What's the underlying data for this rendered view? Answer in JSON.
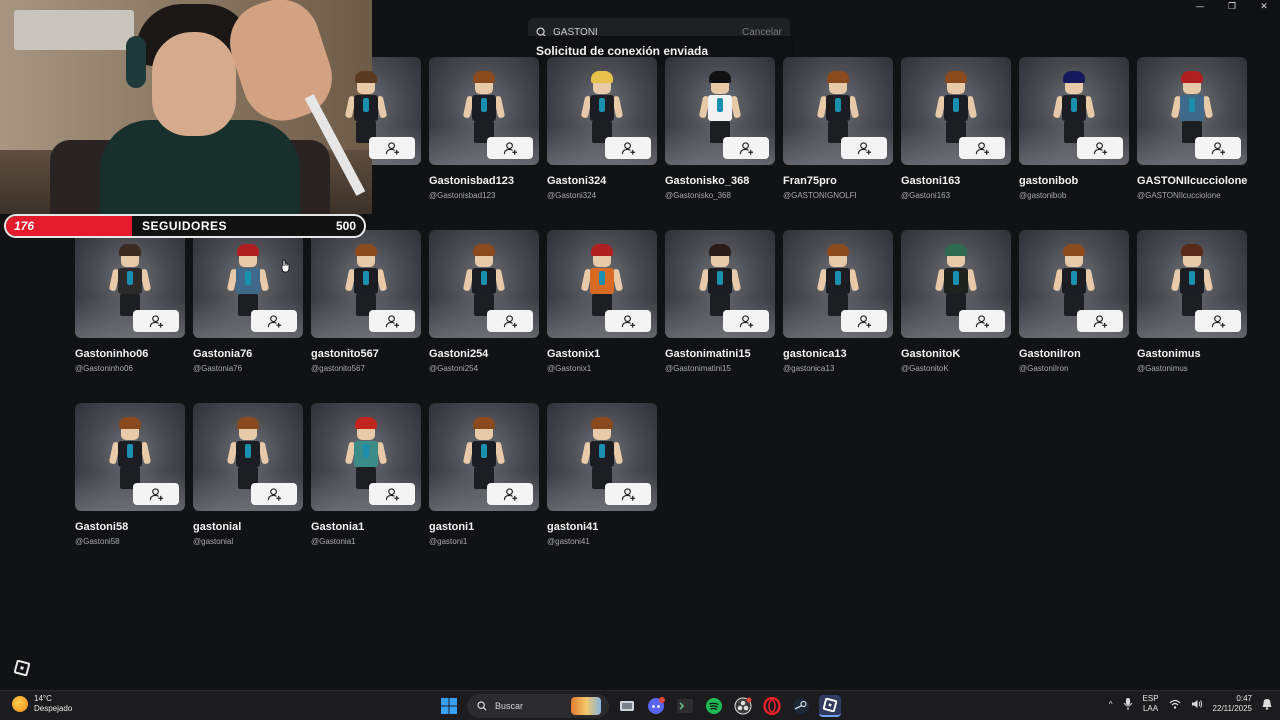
{
  "window": {
    "minimize": "—",
    "restore": "❐",
    "close": "✕"
  },
  "search": {
    "query": "GASTONI",
    "cancel_label": "Cancelar"
  },
  "toast": {
    "message": "Solicitud de conexión enviada"
  },
  "overlay": {
    "followers_current": "176",
    "followers_label": "SEGUIDORES",
    "followers_goal": "500",
    "followers_fraction": 0.352
  },
  "users": [
    {
      "name": "",
      "handle": "",
      "hair": "#5a3b21",
      "shirt": "#1c1d22",
      "head": "#dadde3"
    },
    {
      "name": "Gastonisbad123",
      "handle": "@Gastonisbad123",
      "hair": "#8a4a1e",
      "shirt": "#1c1d22"
    },
    {
      "name": "Gastoni324",
      "handle": "@Gastoni324",
      "hair": "#e6c24a",
      "shirt": "#1c1d22"
    },
    {
      "name": "Gastonisko_368",
      "handle": "@Gastonisko_368",
      "hair": "#111111",
      "shirt": "#f2f2f2"
    },
    {
      "name": "Fran75pro",
      "handle": "@GASTONIGNOLFI",
      "hair": "#8a4a1e",
      "shirt": "#1c1d22"
    },
    {
      "name": "Gastoni163",
      "handle": "@Gastoni163",
      "hair": "#8a4a1e",
      "shirt": "#1c1d22"
    },
    {
      "name": "gastonibob",
      "handle": "@gastonibob",
      "hair": "#151a5c",
      "shirt": "#1c1d22"
    },
    {
      "name": "GASTONIlcucciolone",
      "handle": "@GASTONIlcucciolone",
      "hair": "#b02020",
      "shirt": "#3f6a8c"
    },
    {
      "name": "Gastoninho06",
      "handle": "@Gastoninho06",
      "hair": "#3a2a22",
      "shirt": "#2b2b2b"
    },
    {
      "name": "Gastonia76",
      "handle": "@Gastonia76",
      "hair": "#b02020",
      "shirt": "#3f6a8c"
    },
    {
      "name": "gastonito567",
      "handle": "@gastonito567",
      "hair": "#8a4a1e",
      "shirt": "#1c1d22"
    },
    {
      "name": "Gastoni254",
      "handle": "@Gastoni254",
      "hair": "#8a4a1e",
      "shirt": "#1c1d22"
    },
    {
      "name": "Gastonix1",
      "handle": "@Gastonix1",
      "hair": "#b02020",
      "shirt": "#d86a24"
    },
    {
      "name": "Gastonimatini15",
      "handle": "@Gastonimatini15",
      "hair": "#2b1d17",
      "shirt": "#1c1d22"
    },
    {
      "name": "gastonica13",
      "handle": "@gastonica13",
      "hair": "#8a4a1e",
      "shirt": "#1c1d22"
    },
    {
      "name": "GastonitoK",
      "handle": "@GastonitoK",
      "hair": "#2f6b53",
      "shirt": "#1e2320"
    },
    {
      "name": "GastoniIron",
      "handle": "@GastoniIron",
      "hair": "#8a4a1e",
      "shirt": "#1c1d22"
    },
    {
      "name": "Gastonimus",
      "handle": "@Gastonimus",
      "hair": "#5a2a18",
      "shirt": "#1c1d22"
    },
    {
      "name": "Gastoni58",
      "handle": "@Gastoni58",
      "hair": "#8a4a1e",
      "shirt": "#1c1d22"
    },
    {
      "name": "gastonial",
      "handle": "@gastonial",
      "hair": "#8a4a1e",
      "shirt": "#1c1d22"
    },
    {
      "name": "Gastonia1",
      "handle": "@Gastonia1",
      "hair": "#c0261f",
      "shirt": "#3b8c88"
    },
    {
      "name": "gastoni1",
      "handle": "@gastoni1",
      "hair": "#8a4a1e",
      "shirt": "#1c1d22"
    },
    {
      "name": "gastoni41",
      "handle": "@gastoni41",
      "hair": "#8a4a1e",
      "shirt": "#1c1d22"
    }
  ],
  "taskbar": {
    "weather_temp": "14°C",
    "weather_desc": "Despejado",
    "search_label": "Buscar",
    "lang_1": "ESP",
    "lang_2": "LAA",
    "time": "0:47",
    "date": "22/11/2025"
  }
}
